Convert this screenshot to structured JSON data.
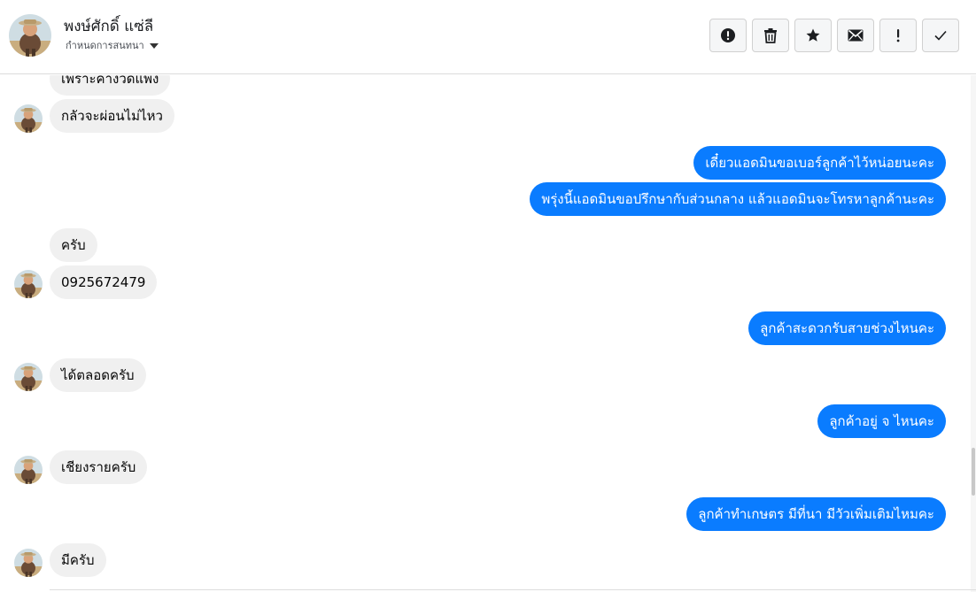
{
  "header": {
    "contact_name": "พงษ์ศักดิ์ แซ่ลี",
    "conversation_setting": "กำหนดการสนทนา",
    "actions": [
      {
        "icon": "alert-circle-icon"
      },
      {
        "icon": "trash-icon"
      },
      {
        "icon": "star-icon"
      },
      {
        "icon": "envelope-icon"
      },
      {
        "icon": "exclamation-icon"
      },
      {
        "icon": "check-icon"
      }
    ]
  },
  "messages": [
    {
      "from": "contact",
      "text": "เพราะค่างวดแพง"
    },
    {
      "from": "contact",
      "text": "กลัวจะผ่อนไม่ไหว"
    },
    {
      "from": "admin",
      "text": "เดี๋ยวแอดมินขอเบอร์ลูกค้าไว้หน่อยนะคะ"
    },
    {
      "from": "admin",
      "text": "พรุ่งนี้แอดมินขอปรึกษากับส่วนกลาง แล้วแอดมินจะโทรหาลูกค้านะคะ"
    },
    {
      "from": "contact",
      "text": "ครับ"
    },
    {
      "from": "contact",
      "text": "0925672479"
    },
    {
      "from": "admin",
      "text": "ลูกค้าสะดวกรับสายช่วงไหนคะ"
    },
    {
      "from": "contact",
      "text": "ได้ตลอดครับ"
    },
    {
      "from": "admin",
      "text": "ลูกค้าอยู่ จ ไหนคะ"
    },
    {
      "from": "contact",
      "text": "เชียงรายครับ"
    },
    {
      "from": "admin",
      "text": "ลูกค้าทำเกษตร มีที่นา มีวัวเพิ่มเติมไหมคะ"
    },
    {
      "from": "contact",
      "text": "มีครับ"
    }
  ],
  "colors": {
    "outgoing_bubble": "#0a7cff",
    "incoming_bubble": "#f0f0f0"
  }
}
